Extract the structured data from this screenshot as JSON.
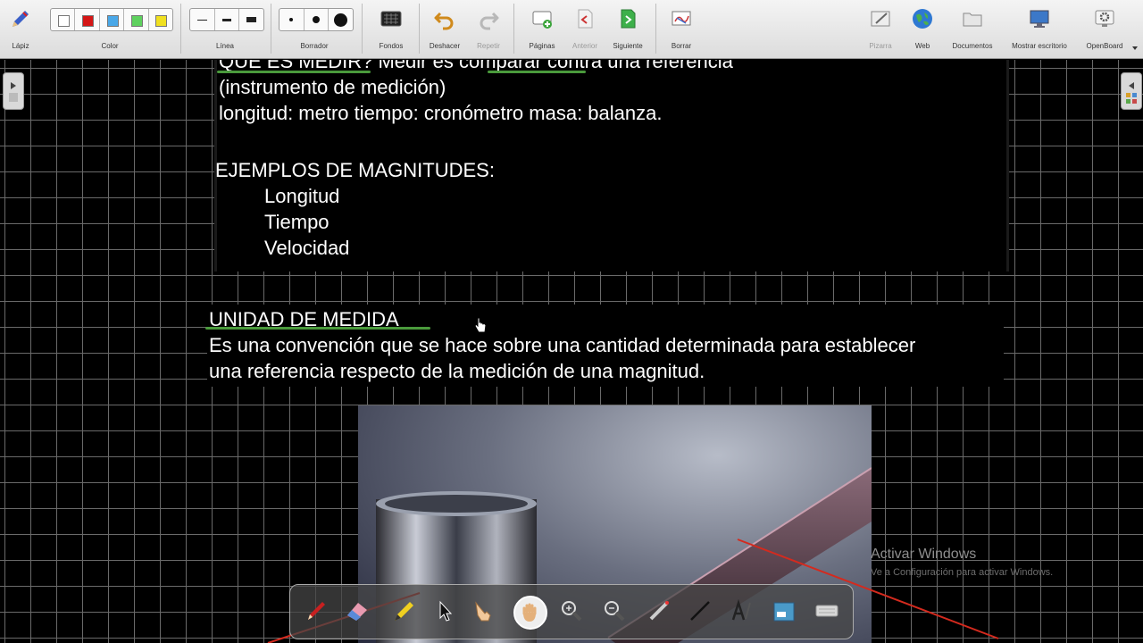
{
  "toolbar": {
    "pencil_label": "Lápiz",
    "color_label": "Color",
    "line_label": "Línea",
    "eraser_label": "Borrador",
    "background_label": "Fondos",
    "undo_label": "Deshacer",
    "redo_label": "Repetir",
    "pages_label": "Páginas",
    "previous_label": "Anterior",
    "next_label": "Siguiente",
    "clear_label": "Borrar",
    "board_label": "Pizarra",
    "web_label": "Web",
    "documents_label": "Documentos",
    "desktop_label": "Mostrar escritorio",
    "openboard_label": "OpenBoard",
    "colors": [
      "#ffffff",
      "#d41616",
      "#4aa8e8",
      "#5fd15f",
      "#f0e020"
    ]
  },
  "board": {
    "line1": "QUÉ ES MEDIR? Medir es comparar contra una referencia",
    "line2": "(instrumento de medición)",
    "line3": "longitud: metro    tiempo: cronómetro     masa: balanza.",
    "examples_title": "EJEMPLOS DE MAGNITUDES:",
    "examples": [
      "Longitud",
      "Tiempo",
      "Velocidad"
    ],
    "unit_title": "UNIDAD DE MEDIDA",
    "unit_line1": "Es una convención que se hace sobre una cantidad determinada para establecer",
    "unit_line2": "una referencia respecto de la medición de una magnitud."
  },
  "watermark": {
    "title": "Activar Windows",
    "subtitle": "Ve a Configuración para activar Windows."
  },
  "colors": {
    "underline": "#4a9a3c",
    "annotation_line": "#d42a1e"
  }
}
